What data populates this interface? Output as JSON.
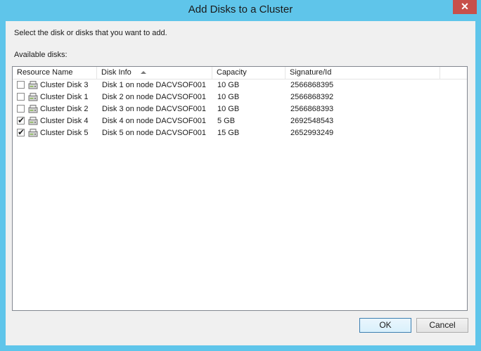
{
  "window": {
    "title": "Add Disks to a Cluster",
    "close_glyph": "✕"
  },
  "instruction": "Select the disk or disks that you want to add.",
  "available_label": "Available disks:",
  "columns": {
    "resource_name": "Resource Name",
    "disk_info": "Disk Info",
    "capacity": "Capacity",
    "signature": "Signature/Id"
  },
  "rows": [
    {
      "checked": false,
      "name": "Cluster Disk 3",
      "info": "Disk 1 on node DACVSOF001",
      "capacity": "10 GB",
      "signature": "2566868395"
    },
    {
      "checked": false,
      "name": "Cluster Disk 1",
      "info": "Disk 2 on node DACVSOF001",
      "capacity": "10 GB",
      "signature": "2566868392"
    },
    {
      "checked": false,
      "name": "Cluster Disk 2",
      "info": "Disk 3 on node DACVSOF001",
      "capacity": "10 GB",
      "signature": "2566868393"
    },
    {
      "checked": true,
      "name": "Cluster Disk 4",
      "info": "Disk 4 on node DACVSOF001",
      "capacity": "5 GB",
      "signature": "2692548543"
    },
    {
      "checked": true,
      "name": "Cluster Disk 5",
      "info": "Disk 5 on node DACVSOF001",
      "capacity": "15 GB",
      "signature": "2652993249"
    }
  ],
  "buttons": {
    "ok": "OK",
    "cancel": "Cancel"
  },
  "colors": {
    "frame": "#5fc5ea",
    "close": "#c7504a",
    "default_button_border": "#3c7fb1"
  },
  "icons": {
    "row_icon": "cluster-disk-icon",
    "sort": "sort-ascending-icon"
  }
}
